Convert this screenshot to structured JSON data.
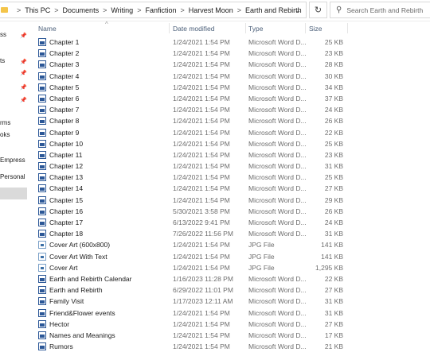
{
  "address": {
    "crumbs": [
      "This PC",
      "Documents",
      "Writing",
      "Fanfiction",
      "Harvest Moon",
      "Earth and Rebirth"
    ],
    "search_placeholder": "Search Earth and Rebirth"
  },
  "nav": {
    "items": [
      {
        "label": "ss",
        "pinned": true
      },
      {
        "label": "ts",
        "pinned": true
      },
      {
        "label": "",
        "pinned": true
      },
      {
        "label": "",
        "pinned": true
      },
      {
        "label": "",
        "pinned": true
      },
      {
        "label": "rms",
        "pinned": false
      },
      {
        "label": "oks",
        "pinned": false
      },
      {
        "label": "Empress",
        "pinned": false
      },
      {
        "label": "Personal",
        "pinned": false
      },
      {
        "label": "",
        "pinned": false,
        "selected": true
      }
    ]
  },
  "columns": {
    "name": "Name",
    "date": "Date modified",
    "type": "Type",
    "size": "Size"
  },
  "files": [
    {
      "name": "Chapter 1",
      "date": "1/24/2021 1:54 PM",
      "type": "Microsoft Word D...",
      "size": "25 KB",
      "icon": "word-doc-icon"
    },
    {
      "name": "Chapter 2",
      "date": "1/24/2021 1:54 PM",
      "type": "Microsoft Word D...",
      "size": "23 KB",
      "icon": "word-doc-icon"
    },
    {
      "name": "Chapter 3",
      "date": "1/24/2021 1:54 PM",
      "type": "Microsoft Word D...",
      "size": "28 KB",
      "icon": "word-doc-icon"
    },
    {
      "name": "Chapter 4",
      "date": "1/24/2021 1:54 PM",
      "type": "Microsoft Word D...",
      "size": "30 KB",
      "icon": "word-doc-icon"
    },
    {
      "name": "Chapter 5",
      "date": "1/24/2021 1:54 PM",
      "type": "Microsoft Word D...",
      "size": "34 KB",
      "icon": "word-doc-icon"
    },
    {
      "name": "Chapter 6",
      "date": "1/24/2021 1:54 PM",
      "type": "Microsoft Word D...",
      "size": "37 KB",
      "icon": "word-doc-icon"
    },
    {
      "name": "Chapter 7",
      "date": "1/24/2021 1:54 PM",
      "type": "Microsoft Word D...",
      "size": "24 KB",
      "icon": "word-doc-icon"
    },
    {
      "name": "Chapter 8",
      "date": "1/24/2021 1:54 PM",
      "type": "Microsoft Word D...",
      "size": "26 KB",
      "icon": "word-doc-icon"
    },
    {
      "name": "Chapter 9",
      "date": "1/24/2021 1:54 PM",
      "type": "Microsoft Word D...",
      "size": "22 KB",
      "icon": "word-doc-icon"
    },
    {
      "name": "Chapter 10",
      "date": "1/24/2021 1:54 PM",
      "type": "Microsoft Word D...",
      "size": "25 KB",
      "icon": "word-doc-icon"
    },
    {
      "name": "Chapter 11",
      "date": "1/24/2021 1:54 PM",
      "type": "Microsoft Word D...",
      "size": "23 KB",
      "icon": "word-doc-icon"
    },
    {
      "name": "Chapter 12",
      "date": "1/24/2021 1:54 PM",
      "type": "Microsoft Word D...",
      "size": "31 KB",
      "icon": "word-doc-icon"
    },
    {
      "name": "Chapter 13",
      "date": "1/24/2021 1:54 PM",
      "type": "Microsoft Word D...",
      "size": "25 KB",
      "icon": "word-doc-icon"
    },
    {
      "name": "Chapter 14",
      "date": "1/24/2021 1:54 PM",
      "type": "Microsoft Word D...",
      "size": "27 KB",
      "icon": "word-doc-icon"
    },
    {
      "name": "Chapter 15",
      "date": "1/24/2021 1:54 PM",
      "type": "Microsoft Word D...",
      "size": "29 KB",
      "icon": "word-doc-icon"
    },
    {
      "name": "Chapter 16",
      "date": "5/30/2021 3:58 PM",
      "type": "Microsoft Word D...",
      "size": "26 KB",
      "icon": "word-doc-icon"
    },
    {
      "name": "Chapter 17",
      "date": "6/13/2022 9:41 PM",
      "type": "Microsoft Word D...",
      "size": "24 KB",
      "icon": "word-doc-icon"
    },
    {
      "name": "Chapter 18",
      "date": "7/26/2022 11:56 PM",
      "type": "Microsoft Word D...",
      "size": "31 KB",
      "icon": "word-doc-icon"
    },
    {
      "name": "Cover Art (600x800)",
      "date": "1/24/2021 1:54 PM",
      "type": "JPG File",
      "size": "141 KB",
      "icon": "jpg-file-icon"
    },
    {
      "name": "Cover Art With Text",
      "date": "1/24/2021 1:54 PM",
      "type": "JPG File",
      "size": "141 KB",
      "icon": "jpg-file-icon"
    },
    {
      "name": "Cover Art",
      "date": "1/24/2021 1:54 PM",
      "type": "JPG File",
      "size": "1,295 KB",
      "icon": "jpg-file-icon"
    },
    {
      "name": "Earth and Rebirth Calendar",
      "date": "1/16/2023 11:28 PM",
      "type": "Microsoft Word D...",
      "size": "22 KB",
      "icon": "word-doc-icon"
    },
    {
      "name": "Earth and Rebirth",
      "date": "6/29/2022 11:01 PM",
      "type": "Microsoft Word D...",
      "size": "27 KB",
      "icon": "word-doc-icon"
    },
    {
      "name": "Family Visit",
      "date": "1/17/2023 12:11 AM",
      "type": "Microsoft Word D...",
      "size": "31 KB",
      "icon": "word-doc-icon"
    },
    {
      "name": "Friend&Flower events",
      "date": "1/24/2021 1:54 PM",
      "type": "Microsoft Word D...",
      "size": "31 KB",
      "icon": "word-doc-icon"
    },
    {
      "name": "Hector",
      "date": "1/24/2021 1:54 PM",
      "type": "Microsoft Word D...",
      "size": "27 KB",
      "icon": "word-doc-icon"
    },
    {
      "name": "Names and Meanings",
      "date": "1/24/2021 1:54 PM",
      "type": "Microsoft Word D...",
      "size": "17 KB",
      "icon": "word-doc-icon"
    },
    {
      "name": "Rumors",
      "date": "1/24/2021 1:54 PM",
      "type": "Microsoft Word D...",
      "size": "21 KB",
      "icon": "word-doc-icon"
    }
  ]
}
